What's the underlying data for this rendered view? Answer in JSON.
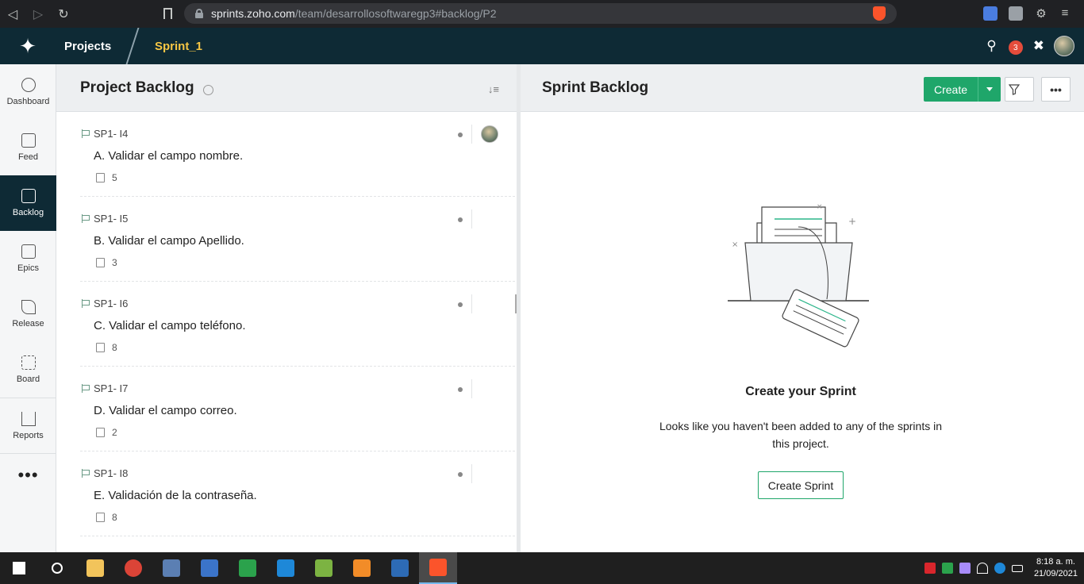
{
  "browser": {
    "url_host": "sprints.zoho.com",
    "url_path": "/team/desarrollosoftwaregp3#backlog/P2"
  },
  "appbar": {
    "projects_label": "Projects",
    "sprint_label": "Sprint_1",
    "notification_count": "3"
  },
  "sidebar": {
    "items": [
      {
        "label": "Dashboard",
        "icon": "dashboard-icon"
      },
      {
        "label": "Feed",
        "icon": "feed-icon"
      },
      {
        "label": "Backlog",
        "icon": "backlog-icon"
      },
      {
        "label": "Epics",
        "icon": "epics-icon"
      },
      {
        "label": "Release",
        "icon": "release-icon"
      },
      {
        "label": "Board",
        "icon": "board-icon"
      },
      {
        "label": "Reports",
        "icon": "reports-icon"
      }
    ],
    "more_label": "•••"
  },
  "project_backlog": {
    "title": "Project Backlog",
    "items": [
      {
        "key": "SP1- I4",
        "name": "A. Validar el campo nombre.",
        "points": "5",
        "owner": "photo"
      },
      {
        "key": "SP1- I5",
        "name": "B. Validar el campo Apellido.",
        "points": "3",
        "owner": "empty"
      },
      {
        "key": "SP1- I6",
        "name": "C. Validar el campo teléfono.",
        "points": "8",
        "owner": "empty"
      },
      {
        "key": "SP1- I7",
        "name": "D. Validar el campo correo.",
        "points": "2",
        "owner": "empty"
      },
      {
        "key": "SP1- I8",
        "name": "E. Validación de la contraseña.",
        "points": "8",
        "owner": "empty"
      }
    ]
  },
  "sprint_backlog": {
    "title": "Sprint Backlog",
    "create_label": "Create",
    "more_label": "•••",
    "empty_title": "Create your Sprint",
    "empty_text": "Looks like you haven't been added to any of the sprints in this project.",
    "create_sprint_label": "Create Sprint"
  },
  "taskbar": {
    "time": "8:18 a. m.",
    "date": "21/09/2021"
  },
  "colors": {
    "header_bg": "#0e2a35",
    "sprint_accent": "#f6c644",
    "primary_green": "#1fa66a",
    "badge_red": "#e44c3b"
  }
}
